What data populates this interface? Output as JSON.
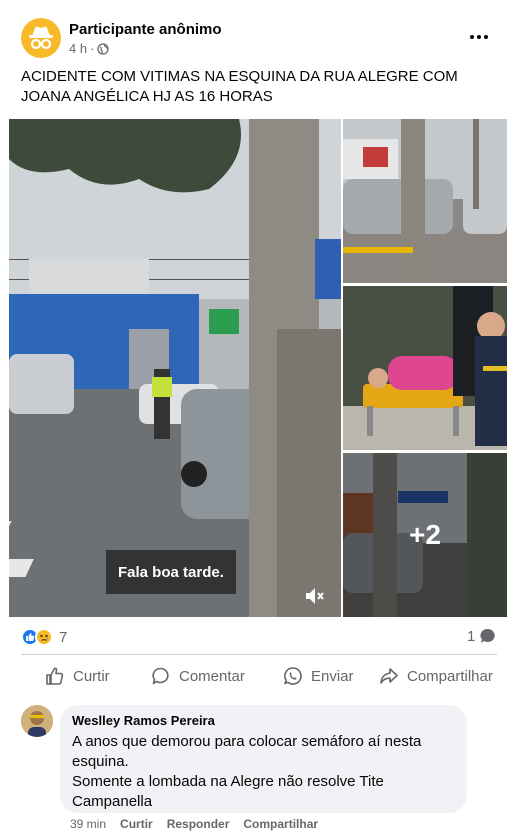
{
  "post": {
    "author": "Participante anônimo",
    "time": "4 h",
    "separator": "·",
    "text": "ACIDENTE COM VITIMAS NA ESQUINA DA RUA ALEGRE COM JOANA ANGÉLICA HJ AS 16 HORAS"
  },
  "media": {
    "video_caption": "Fala boa tarde.",
    "more_count": "+2"
  },
  "stats": {
    "reaction_count": "7",
    "comment_count": "1"
  },
  "actions": {
    "like": "Curtir",
    "comment": "Comentar",
    "send": "Enviar",
    "share": "Compartilhar"
  },
  "comment": {
    "author": "Weslley Ramos Pereira",
    "lines": [
      "A anos que demorou para colocar semáforo aí nesta",
      "esquina.",
      "Somente a lombada na Alegre não resolve Tite",
      "Campanella"
    ],
    "time": "39 min",
    "like": "Curtir",
    "reply": "Responder",
    "share": "Compartilhar"
  },
  "colors": {
    "accent": "#1877f2",
    "anon_avatar": "#f7b928",
    "secondary_text": "#65676b",
    "bubble": "#f0f2f5"
  },
  "icons": [
    "incognito-icon",
    "globe-icon",
    "more-icon",
    "like-reaction-icon",
    "sad-reaction-icon",
    "comment-bubble-icon",
    "thumbs-up-icon",
    "comment-icon",
    "whatsapp-icon",
    "share-icon",
    "volume-mute-icon"
  ]
}
